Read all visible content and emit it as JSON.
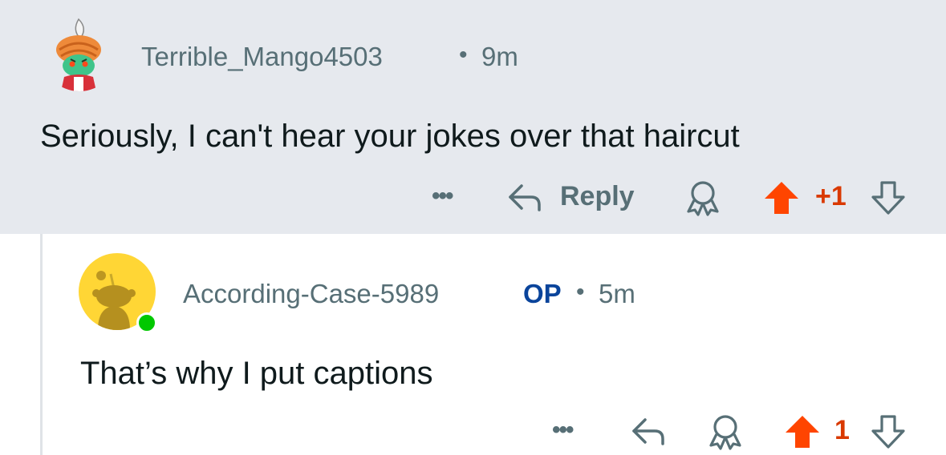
{
  "comments": [
    {
      "username": "Terrible_Mango4503",
      "separator": "•",
      "time": "9m",
      "body": "Seriously, I can't hear your jokes over that haircut",
      "more": "•••",
      "reply_label": "Reply",
      "score": "+1",
      "avatar_icon": "snoo-avatar-turban-icon",
      "colors": {
        "background": "#e6e9ee",
        "upvote": "#ff4500",
        "score": "#d93900"
      }
    },
    {
      "username": "According-Case-5989",
      "op_badge": "OP",
      "separator": "•",
      "time": "5m",
      "body": "That’s why I put captions",
      "more": "•••",
      "score": "1",
      "avatar_icon": "default-snoo-avatar-icon",
      "online": true,
      "colors": {
        "avatar": "#ffd635",
        "op": "#0a449b",
        "online": "#01c800"
      }
    }
  ]
}
